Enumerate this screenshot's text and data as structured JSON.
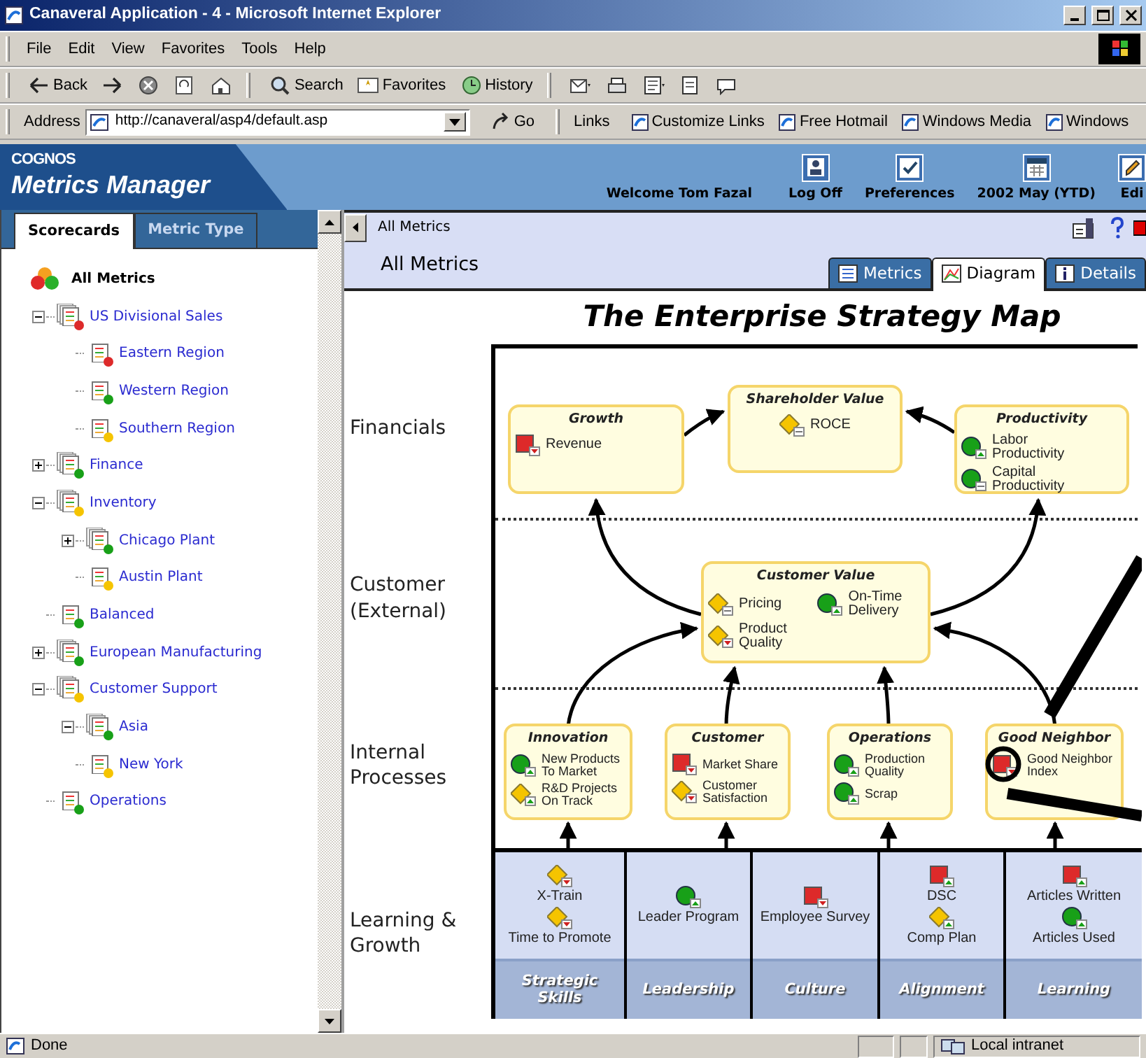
{
  "window": {
    "title": "Canaveral Application - 4 - Microsoft Internet Explorer"
  },
  "menu": [
    "File",
    "Edit",
    "View",
    "Favorites",
    "Tools",
    "Help"
  ],
  "toolbar": [
    {
      "kind": "back",
      "label": "Back"
    },
    {
      "kind": "forward"
    },
    {
      "kind": "stop"
    },
    {
      "kind": "refresh"
    },
    {
      "kind": "home"
    },
    {
      "kind": "search",
      "label": "Search"
    },
    {
      "kind": "favorites",
      "label": "Favorites"
    },
    {
      "kind": "history",
      "label": "History"
    },
    {
      "kind": "mail"
    },
    {
      "kind": "print"
    },
    {
      "kind": "edit"
    },
    {
      "kind": "document"
    },
    {
      "kind": "discuss"
    }
  ],
  "address": {
    "label": "Address",
    "value": "http://canaveral/asp4/default.asp",
    "go": "Go"
  },
  "links": {
    "label": "Links",
    "items": [
      "Customize Links",
      "Free Hotmail",
      "Windows Media",
      "Windows"
    ]
  },
  "app_header": {
    "brand": "COGNOS",
    "product": "Metrics Manager",
    "welcome": "Welcome Tom Fazal",
    "actions": [
      {
        "kind": "logoff",
        "label": "Log Off"
      },
      {
        "kind": "preferences",
        "label": "Preferences"
      },
      {
        "kind": "calendar",
        "label": "2002 May (YTD)"
      },
      {
        "kind": "edit",
        "label": "Edi"
      }
    ]
  },
  "sidebar": {
    "tabs": [
      {
        "label": "Scorecards",
        "selected": true
      },
      {
        "label": "Metric Type",
        "selected": false
      }
    ],
    "tree": {
      "label": "All Metrics",
      "children": [
        {
          "label": "US Divisional Sales",
          "kind": "group",
          "color": "#dd2a2a",
          "expanded": true,
          "children": [
            {
              "label": "Eastern Region",
              "kind": "single",
              "color": "#dd2a2a"
            },
            {
              "label": "Western Region",
              "kind": "single",
              "color": "#18a018"
            },
            {
              "label": "Southern Region",
              "kind": "single",
              "color": "#f5c400"
            }
          ]
        },
        {
          "label": "Finance",
          "kind": "group",
          "color": "#18a018",
          "expanded": false
        },
        {
          "label": "Inventory",
          "kind": "group",
          "color": "#f5c400",
          "expanded": true,
          "children": [
            {
              "label": "Chicago Plant",
              "kind": "group",
              "color": "#18a018",
              "expanded": false
            },
            {
              "label": "Austin Plant",
              "kind": "single",
              "color": "#f5c400"
            }
          ]
        },
        {
          "label": "Balanced",
          "kind": "single",
          "color": "#18a018"
        },
        {
          "label": "European Manufacturing",
          "kind": "group",
          "color": "#18a018",
          "expanded": false
        },
        {
          "label": "Customer Support",
          "kind": "group",
          "color": "#f5c400",
          "expanded": true,
          "children": [
            {
              "label": "Asia",
              "kind": "group",
              "color": "#18a018",
              "expanded": true
            },
            {
              "label": "New York",
              "kind": "single",
              "color": "#f5c400"
            }
          ]
        },
        {
          "label": "Operations",
          "kind": "single",
          "color": "#18a018"
        }
      ]
    }
  },
  "breadcrumb": "All Metrics",
  "page_title": "All Metrics",
  "view_tabs": [
    {
      "label": "Metrics",
      "kind": "list",
      "selected": false
    },
    {
      "label": "Diagram",
      "kind": "chart",
      "selected": true
    },
    {
      "label": "Details",
      "kind": "info",
      "selected": false
    }
  ],
  "map": {
    "title": "The Enterprise Strategy Map",
    "rows": [
      "Financials",
      "Customer (External)",
      "Internal Processes",
      "Learning & Growth"
    ],
    "objectives": [
      {
        "title": "Growth",
        "metrics": [
          {
            "label": "Revenue",
            "kind": "square",
            "color": "#dd2a2a",
            "trend": {
              "kind": "down"
            }
          }
        ]
      },
      {
        "title": "Shareholder Value",
        "metrics": [
          {
            "label": "ROCE",
            "kind": "diamond",
            "color": "#f5c400",
            "trend": {
              "kind": "flat"
            }
          }
        ]
      },
      {
        "title": "Productivity",
        "metrics": [
          {
            "label": "Labor Productivity",
            "kind": "circle",
            "color": "#18a018",
            "trend": {
              "kind": "up"
            }
          },
          {
            "label": "Capital Productivity",
            "kind": "circle",
            "color": "#18a018",
            "trend": {
              "kind": "flat"
            }
          }
        ]
      },
      {
        "title": "Customer Value",
        "metrics": [
          {
            "label": "Pricing",
            "kind": "diamond",
            "color": "#f5c400",
            "trend": {
              "kind": "flat"
            }
          },
          {
            "label": "On-Time Delivery",
            "kind": "circle",
            "color": "#18a018",
            "trend": {
              "kind": "up"
            }
          },
          {
            "label": "Product Quality",
            "kind": "diamond",
            "color": "#f5c400",
            "trend": {
              "kind": "down"
            }
          }
        ]
      },
      {
        "title": "Innovation",
        "metrics": [
          {
            "label": "New Products To Market",
            "kind": "circle",
            "color": "#18a018",
            "trend": {
              "kind": "up"
            }
          },
          {
            "label": "R&D Projects On Track",
            "kind": "diamond",
            "color": "#f5c400",
            "trend": {
              "kind": "up"
            }
          }
        ]
      },
      {
        "title": "Customer",
        "metrics": [
          {
            "label": "Market Share",
            "kind": "square",
            "color": "#dd2a2a",
            "trend": {
              "kind": "down"
            }
          },
          {
            "label": "Customer Satisfaction",
            "kind": "diamond",
            "color": "#f5c400",
            "trend": {
              "kind": "down"
            }
          }
        ]
      },
      {
        "title": "Operations",
        "metrics": [
          {
            "label": "Production Quality",
            "kind": "circle",
            "color": "#18a018",
            "trend": {
              "kind": "up"
            }
          },
          {
            "label": "Scrap",
            "kind": "circle",
            "color": "#18a018",
            "trend": {
              "kind": "up"
            }
          }
        ]
      },
      {
        "title": "Good Neighbor",
        "metrics": [
          {
            "label": "Good Neighbor Index",
            "kind": "square",
            "color": "#dd2a2a",
            "trend": {
              "kind": "down"
            }
          }
        ]
      }
    ],
    "learning": [
      {
        "title": "Strategic Skills",
        "metrics": [
          {
            "label": "X-Train",
            "kind": "diamond",
            "color": "#f5c400",
            "trend": {
              "kind": "down"
            }
          },
          {
            "label": "Time to Promote",
            "kind": "diamond",
            "color": "#f5c400",
            "trend": {
              "kind": "down"
            }
          }
        ]
      },
      {
        "title": "Leadership",
        "metrics": [
          {
            "label": "Leader Program",
            "kind": "circle",
            "color": "#18a018",
            "trend": {
              "kind": "up"
            }
          }
        ]
      },
      {
        "title": "Culture",
        "metrics": [
          {
            "label": "Employee Survey",
            "kind": "square",
            "color": "#dd2a2a",
            "trend": {
              "kind": "down"
            }
          }
        ]
      },
      {
        "title": "Alignment",
        "metrics": [
          {
            "label": "DSC",
            "kind": "square",
            "color": "#dd2a2a",
            "trend": {
              "kind": "up"
            }
          },
          {
            "label": "Comp Plan",
            "kind": "diamond",
            "color": "#f5c400",
            "trend": {
              "kind": "up"
            }
          }
        ]
      },
      {
        "title": "Learning",
        "metrics": [
          {
            "label": "Articles Written",
            "kind": "square",
            "color": "#dd2a2a",
            "trend": {
              "kind": "up"
            }
          },
          {
            "label": "Articles Used",
            "kind": "circle",
            "color": "#18a018",
            "trend": {
              "kind": "up"
            }
          }
        ]
      }
    ]
  },
  "status_bar": {
    "text": "Done",
    "zone": "Local intranet"
  }
}
